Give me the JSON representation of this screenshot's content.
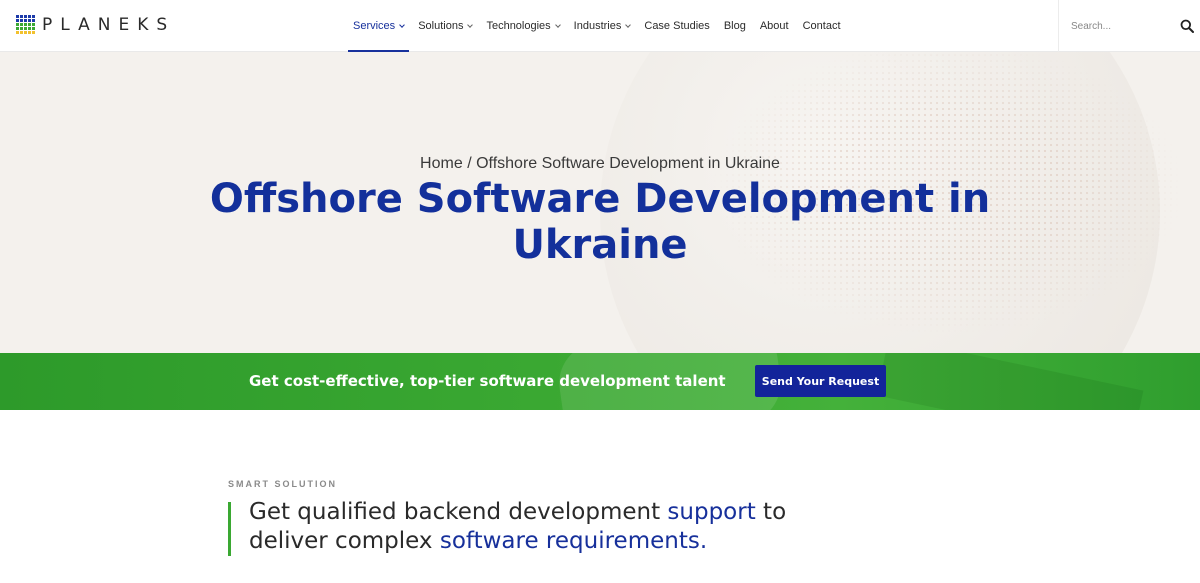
{
  "brand": {
    "name": "PLANEKS",
    "logo_colors": [
      "#1c3aa9",
      "#3aa832",
      "#f2c12e"
    ]
  },
  "nav": {
    "items": [
      {
        "label": "Services",
        "dropdown": true,
        "active": true
      },
      {
        "label": "Solutions",
        "dropdown": true,
        "active": false
      },
      {
        "label": "Technologies",
        "dropdown": true,
        "active": false
      },
      {
        "label": "Industries",
        "dropdown": true,
        "active": false
      },
      {
        "label": "Case Studies",
        "dropdown": false,
        "active": false
      },
      {
        "label": "Blog",
        "dropdown": false,
        "active": false
      },
      {
        "label": "About",
        "dropdown": false,
        "active": false
      },
      {
        "label": "Contact",
        "dropdown": false,
        "active": false
      }
    ]
  },
  "search": {
    "placeholder": "Search...",
    "icon": "search-icon"
  },
  "hero": {
    "breadcrumb_home": "Home",
    "breadcrumb_separator": "/",
    "breadcrumb_current": "Offshore Software Development in Ukraine",
    "title": "Offshore Software Development in Ukraine"
  },
  "banner": {
    "text": "Get cost-effective, top-tier software development talent",
    "button_label": "Send Your Request"
  },
  "section": {
    "eyebrow": "SMART SOLUTION",
    "quote_part1": "Get qualified backend development ",
    "quote_highlight1": "support",
    "quote_part2": " to deliver complex ",
    "quote_highlight2": "software requirements."
  },
  "colors": {
    "primary": "#13309b",
    "accent_green": "#3aa832",
    "button_bg": "#13249a",
    "hero_bg": "#f4f1ed"
  }
}
